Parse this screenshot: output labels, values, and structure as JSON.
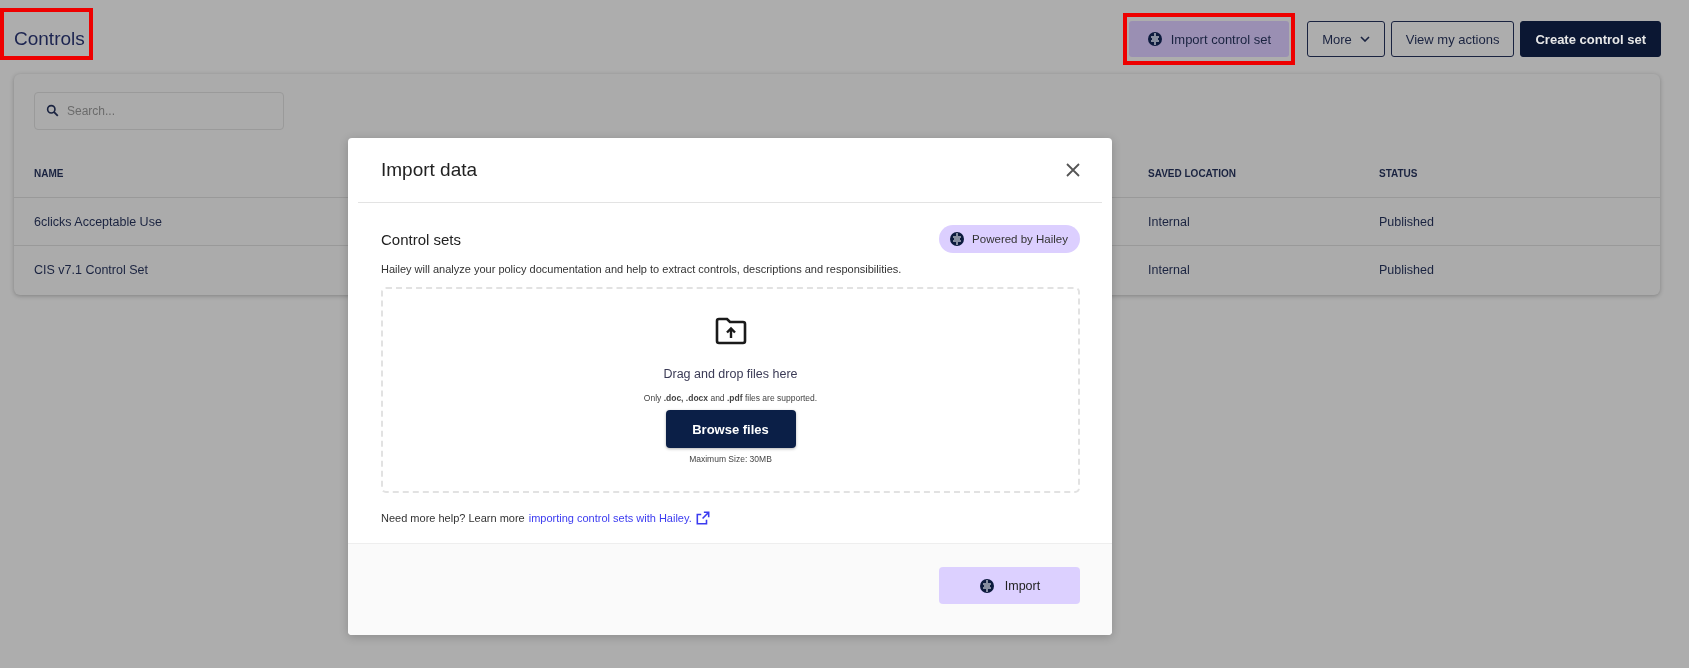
{
  "page": {
    "title": "Controls",
    "highlighted": true
  },
  "actions": [
    {
      "label": "Import control set",
      "kind": "ai",
      "highlighted": true
    },
    {
      "label": "More",
      "kind": "dropdown",
      "highlighted": false
    },
    {
      "label": "View my actions",
      "kind": "outline",
      "highlighted": false
    },
    {
      "label": "Create control set",
      "kind": "primary",
      "highlighted": false
    }
  ],
  "search": {
    "placeholder": "Search..."
  },
  "table": {
    "columns": [
      "NAME",
      "SAVED LOCATION",
      "STATUS"
    ],
    "rows": [
      {
        "name": "6clicks Acceptable Use",
        "saved_location": "Internal",
        "status": "Published"
      },
      {
        "name": "CIS v7.1 Control Set",
        "saved_location": "Internal",
        "status": "Published"
      }
    ]
  },
  "dialog": {
    "title": "Import data",
    "section_title": "Control sets",
    "badge": "Powered by Hailey",
    "description": "Hailey will analyze your policy documentation and help to extract controls, descriptions and responsibilities.",
    "drop_title": "Drag and drop files here",
    "drop_hint": "Only **.doc, .docx** and **.pdf** files are supported.",
    "browse_button": "Browse files",
    "max_size": "Maximum Size: 30MB",
    "help_text": "Need more help? Learn more",
    "help_link": "importing control sets with Hailey.",
    "import_button": "Import"
  }
}
